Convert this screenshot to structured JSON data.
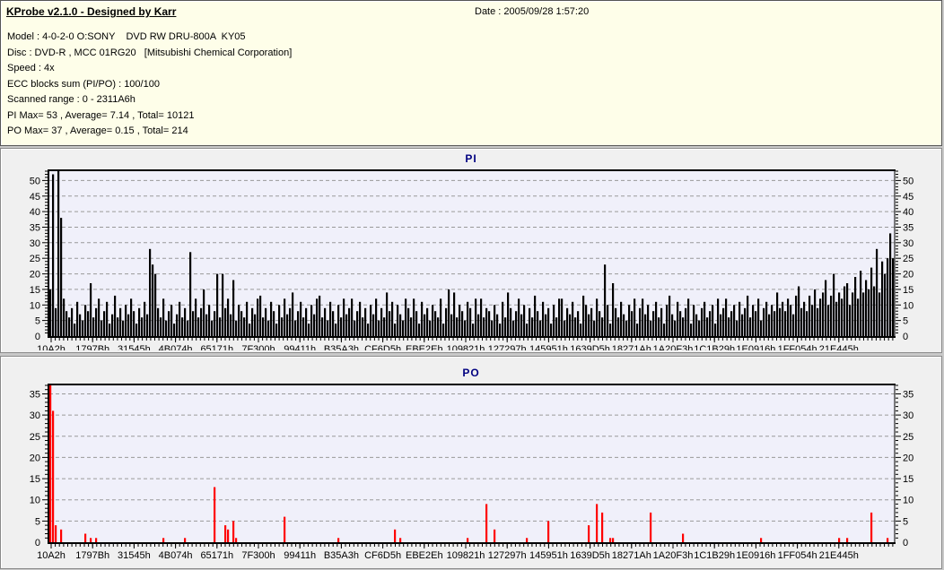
{
  "header": {
    "title": "KProbe v2.1.0 - Designed by Karr",
    "date_label": "Date : 2005/09/28 1:57:20"
  },
  "info": {
    "lines": [
      "Model : 4-0-2-0 O:SONY    DVD RW DRU-800A  KY05",
      "Disc : DVD-R , MCC 01RG20   [Mitsubishi Chemical Corporation]",
      "Speed : 4x",
      "ECC blocks sum (PI/PO) : 100/100",
      "Scanned range : 0 - 2311A6h",
      "PI Max= 53 , Average= 7.14 , Total= 10121",
      "PO Max= 37 , Average= 0.15 , Total= 214"
    ]
  },
  "chart_data": [
    {
      "type": "bar",
      "title": "PI",
      "color": "#000000",
      "plot_bg": "#f0f0fa",
      "grid_color": "#999999",
      "grid": "dashed-horizontal",
      "legend": "none",
      "xlabel": "",
      "ylabel": "",
      "ylim": [
        0,
        53
      ],
      "stats": {
        "max": 53,
        "average": 7.14,
        "total": 10121
      },
      "yticks": [
        0,
        5,
        10,
        15,
        20,
        25,
        30,
        35,
        40,
        45,
        50
      ],
      "x_labels": [
        "10A2h",
        "1797Bh",
        "31545h",
        "4B074h",
        "65171h",
        "7F300h",
        "99411h",
        "B35A3h",
        "CF6D5h",
        "EBE2Eh",
        "109821h",
        "127297h",
        "145951h",
        "1639D5h",
        "18271Ah",
        "1A20F3h",
        "1C1B29h",
        "1E0916h",
        "1FF054h",
        "21E445h"
      ],
      "values": [
        15,
        52,
        9,
        53,
        38,
        12,
        8,
        6,
        9,
        4,
        11,
        7,
        5,
        10,
        8,
        17,
        6,
        9,
        12,
        5,
        8,
        11,
        4,
        7,
        13,
        6,
        9,
        5,
        10,
        7,
        12,
        8,
        4,
        9,
        6,
        11,
        7,
        28,
        23,
        20,
        9,
        6,
        12,
        5,
        8,
        10,
        4,
        7,
        11,
        6,
        9,
        5,
        27,
        8,
        12,
        6,
        9,
        15,
        7,
        10,
        5,
        8,
        20,
        6,
        20,
        9,
        12,
        7,
        18,
        5,
        10,
        8,
        6,
        11,
        4,
        9,
        7,
        12,
        13,
        6,
        9,
        5,
        11,
        8,
        4,
        10,
        6,
        12,
        7,
        9,
        14,
        5,
        8,
        11,
        6,
        9,
        4,
        10,
        7,
        12,
        13,
        6,
        9,
        5,
        11,
        8,
        4,
        10,
        6,
        12,
        7,
        9,
        12,
        5,
        8,
        11,
        6,
        9,
        4,
        10,
        7,
        12,
        5,
        9,
        6,
        14,
        8,
        11,
        4,
        10,
        7,
        5,
        12,
        9,
        6,
        12,
        8,
        4,
        11,
        7,
        9,
        5,
        10,
        8,
        6,
        12,
        4,
        9,
        15,
        7,
        14,
        6,
        10,
        8,
        5,
        11,
        9,
        4,
        12,
        7,
        12,
        6,
        9,
        8,
        5,
        10,
        7,
        4,
        11,
        6,
        14,
        9,
        5,
        8,
        12,
        7,
        10,
        4,
        9,
        6,
        13,
        8,
        5,
        11,
        7,
        9,
        4,
        10,
        6,
        12,
        12,
        5,
        9,
        7,
        11,
        6,
        8,
        4,
        13,
        10,
        7,
        9,
        5,
        12,
        8,
        6,
        23,
        10,
        4,
        17,
        9,
        6,
        11,
        7,
        5,
        10,
        8,
        12,
        4,
        9,
        12,
        7,
        10,
        5,
        8,
        11,
        6,
        9,
        4,
        10,
        13,
        7,
        5,
        11,
        8,
        6,
        9,
        12,
        4,
        10,
        7,
        5,
        9,
        11,
        6,
        8,
        10,
        4,
        12,
        7,
        9,
        12,
        6,
        8,
        10,
        5,
        11,
        7,
        9,
        13,
        6,
        10,
        8,
        12,
        5,
        9,
        11,
        7,
        10,
        8,
        14,
        9,
        11,
        8,
        12,
        10,
        7,
        13,
        16,
        9,
        11,
        8,
        13,
        10,
        15,
        9,
        12,
        14,
        18,
        10,
        13,
        20,
        11,
        14,
        12,
        16,
        17,
        10,
        14,
        19,
        12,
        21,
        14,
        18,
        15,
        22,
        16,
        28,
        14,
        24,
        20,
        25,
        33,
        25
      ]
    },
    {
      "type": "bar",
      "title": "PO",
      "color": "#ff0000",
      "plot_bg": "#f0f0fa",
      "grid_color": "#999999",
      "grid": "dashed-horizontal",
      "legend": "none",
      "xlabel": "",
      "ylabel": "",
      "ylim": [
        0,
        37
      ],
      "stats": {
        "max": 37,
        "average": 0.15,
        "total": 214
      },
      "yticks": [
        0,
        5,
        10,
        15,
        20,
        25,
        30,
        35
      ],
      "x_labels": [
        "10A2h",
        "1797Bh",
        "31545h",
        "4B074h",
        "65171h",
        "7F300h",
        "99411h",
        "B35A3h",
        "CF6D5h",
        "EBE2Eh",
        "109821h",
        "127297h",
        "145951h",
        "1639D5h",
        "18271Ah",
        "1A20F3h",
        "1C1B29h",
        "1E0916h",
        "1FF054h",
        "21E445h"
      ],
      "values": [
        37,
        31,
        4,
        0,
        3,
        0,
        0,
        0,
        0,
        0,
        0,
        0,
        0,
        2,
        0,
        1,
        0,
        1,
        0,
        0,
        0,
        0,
        0,
        0,
        0,
        0,
        0,
        0,
        0,
        0,
        0,
        0,
        0,
        0,
        0,
        0,
        0,
        0,
        0,
        0,
        0,
        0,
        1,
        0,
        0,
        0,
        0,
        0,
        0,
        0,
        1,
        0,
        0,
        0,
        0,
        0,
        0,
        0,
        0,
        0,
        0,
        13,
        0,
        0,
        0,
        4,
        3,
        0,
        5,
        1,
        0,
        0,
        0,
        0,
        0,
        0,
        0,
        0,
        0,
        0,
        0,
        0,
        0,
        0,
        0,
        0,
        0,
        6,
        0,
        0,
        0,
        0,
        0,
        0,
        0,
        0,
        0,
        0,
        0,
        0,
        0,
        0,
        0,
        0,
        0,
        0,
        0,
        1,
        0,
        0,
        0,
        0,
        0,
        0,
        0,
        0,
        0,
        0,
        0,
        0,
        0,
        0,
        0,
        0,
        0,
        0,
        0,
        0,
        3,
        0,
        1,
        0,
        0,
        0,
        0,
        0,
        0,
        0,
        0,
        0,
        0,
        0,
        0,
        0,
        0,
        0,
        0,
        0,
        0,
        0,
        0,
        0,
        0,
        0,
        0,
        1,
        0,
        0,
        0,
        0,
        0,
        0,
        9,
        0,
        0,
        3,
        0,
        0,
        0,
        0,
        0,
        0,
        0,
        0,
        0,
        0,
        0,
        1,
        0,
        0,
        0,
        0,
        0,
        0,
        0,
        5,
        0,
        0,
        0,
        0,
        0,
        0,
        0,
        0,
        0,
        0,
        0,
        0,
        0,
        0,
        4,
        0,
        0,
        9,
        0,
        7,
        0,
        0,
        1,
        1,
        0,
        0,
        0,
        0,
        0,
        0,
        0,
        0,
        0,
        0,
        0,
        0,
        0,
        7,
        0,
        0,
        0,
        0,
        0,
        0,
        0,
        0,
        0,
        0,
        0,
        2,
        0,
        0,
        0,
        0,
        0,
        0,
        0,
        0,
        0,
        0,
        0,
        0,
        0,
        0,
        0,
        0,
        0,
        0,
        0,
        0,
        0,
        0,
        0,
        0,
        0,
        0,
        0,
        0,
        1,
        0,
        0,
        0,
        0,
        0,
        0,
        0,
        0,
        0,
        0,
        0,
        0,
        0,
        0,
        0,
        0,
        0,
        0,
        0,
        0,
        0,
        0,
        0,
        0,
        0,
        0,
        0,
        0,
        1,
        0,
        0,
        1,
        0,
        0,
        0,
        0,
        0,
        0,
        0,
        0,
        7,
        0,
        0,
        0,
        0,
        0,
        1,
        0,
        0
      ]
    }
  ]
}
